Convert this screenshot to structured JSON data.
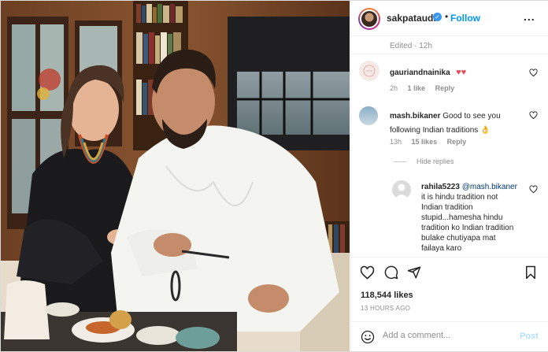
{
  "post": {
    "username": "sakpataudi",
    "follow_label": "Follow",
    "separator": "•",
    "more_label": "...",
    "edited_label": "Edited · 12h"
  },
  "comments": [
    {
      "username": "gauriandnainika",
      "text": "",
      "emoji": "♥♥",
      "time": "2h",
      "likes": "1 like",
      "reply": "Reply"
    },
    {
      "username": "mash.bikaner",
      "text": "Good to see you following Indian traditions 👌",
      "time": "13h",
      "likes": "15 likes",
      "reply": "Reply"
    }
  ],
  "hide_replies_label": "Hide replies",
  "reply_comment": {
    "username": "rahila5223",
    "mention": "@mash.bikaner",
    "text": "it is hindu tradition not Indian tradition stupid...hamesha hindu tradition ko Indian tradition bulake chutiyapa mat failaya karo"
  },
  "actions": {
    "likes_count": "118,544 likes",
    "time_ago": "13 HOURS AGO"
  },
  "comment_box": {
    "placeholder": "Add a comment...",
    "post_label": "Post"
  },
  "colors": {
    "link_blue": "#0095f6",
    "verified_blue": "#3897f0",
    "post_disabled": "#b2dffc",
    "heart_red": "#ed4956"
  },
  "icons": [
    "verified-badge-icon",
    "more-icon",
    "heart-icon",
    "comment-icon",
    "share-icon",
    "bookmark-icon",
    "emoji-icon"
  ]
}
